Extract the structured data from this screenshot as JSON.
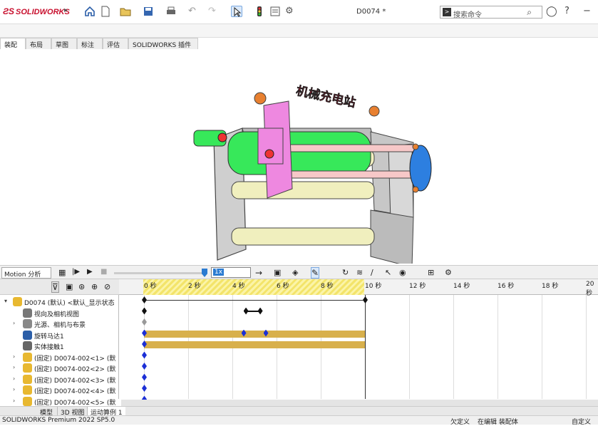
{
  "app": {
    "logo": "SOLIDWORKS",
    "document_title": "D0074 *"
  },
  "search": {
    "placeholder": "搜索命令"
  },
  "tabs": [
    "装配体",
    "布局",
    "草图",
    "标注",
    "评估",
    "SOLIDWORKS 插件"
  ],
  "model_label": "机械充电站",
  "motion": {
    "study_type": "Motion 分析",
    "speed": "1x",
    "time_ticks": [
      "0 秒",
      "2 秒",
      "4 秒",
      "6 秒",
      "8 秒",
      "10 秒",
      "12 秒",
      "14 秒",
      "16 秒",
      "18 秒",
      "20 秒"
    ],
    "tree": [
      {
        "label": "D0074 (默认) <默认_显示状态",
        "icon": "assembly-icon",
        "expand": "▾"
      },
      {
        "label": "视向及相机视图",
        "icon": "camera-icon",
        "expand": ""
      },
      {
        "label": "光源、相机与布景",
        "icon": "lights-icon",
        "expand": "›"
      },
      {
        "label": "旋转马达1",
        "icon": "motor-icon",
        "expand": ""
      },
      {
        "label": "实体接触1",
        "icon": "contact-icon",
        "expand": ""
      },
      {
        "label": "(固定) D0074-002<1> (默",
        "icon": "part-icon",
        "expand": "›"
      },
      {
        "label": "(固定) D0074-002<2> (默",
        "icon": "part-icon",
        "expand": "›"
      },
      {
        "label": "(固定) D0074-002<3> (默",
        "icon": "part-icon",
        "expand": "›"
      },
      {
        "label": "(固定) D0074-002<4> (默",
        "icon": "part-icon",
        "expand": "›"
      },
      {
        "label": "(固定) D0074-002<5> (默",
        "icon": "part-icon",
        "expand": "›"
      }
    ],
    "bottom_tabs": [
      "模型",
      "3D 视图",
      "运动算例 1"
    ]
  },
  "status": {
    "left": "SOLIDWORKS Premium 2022 SP5.0",
    "under_defined": "欠定义",
    "editing": "在编辑 装配体",
    "custom": "自定义"
  },
  "colors": {
    "brand": "#c8102e",
    "keyframe_blue": "#1c2fd6",
    "bar_gold": "#d8b04c",
    "model_green": "#37e85a",
    "model_pink": "#ee88e0",
    "model_blue": "#2d7fe0"
  }
}
